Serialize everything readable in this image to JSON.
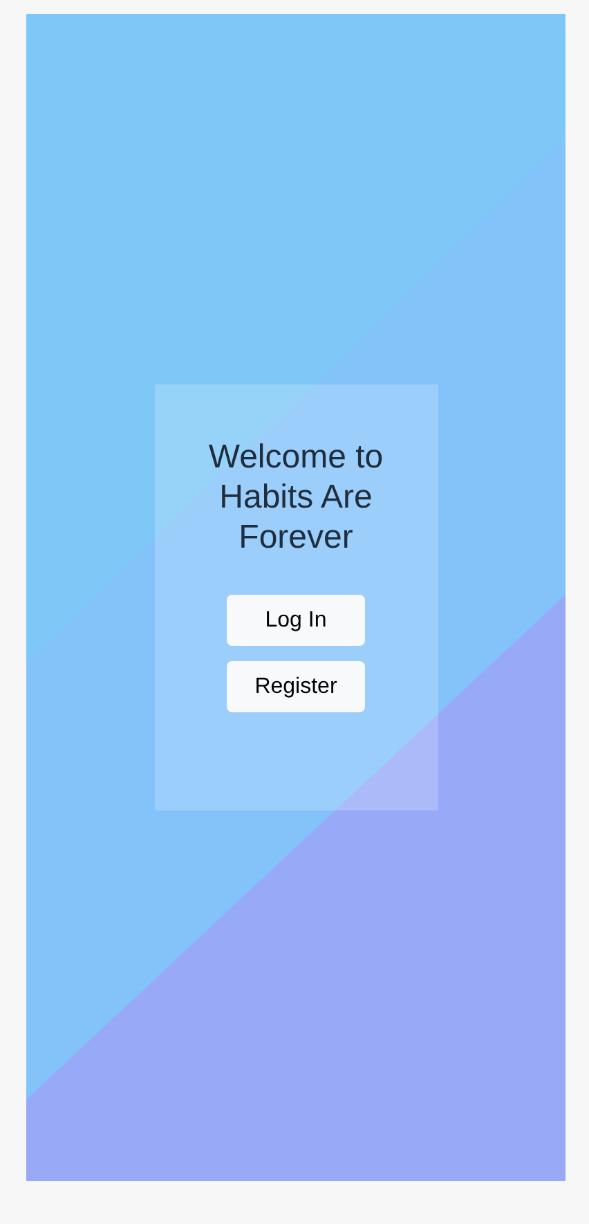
{
  "card": {
    "title": "Welcome to Habits Are Forever"
  },
  "buttons": [
    {
      "label": "Log In"
    },
    {
      "label": "Register"
    }
  ]
}
